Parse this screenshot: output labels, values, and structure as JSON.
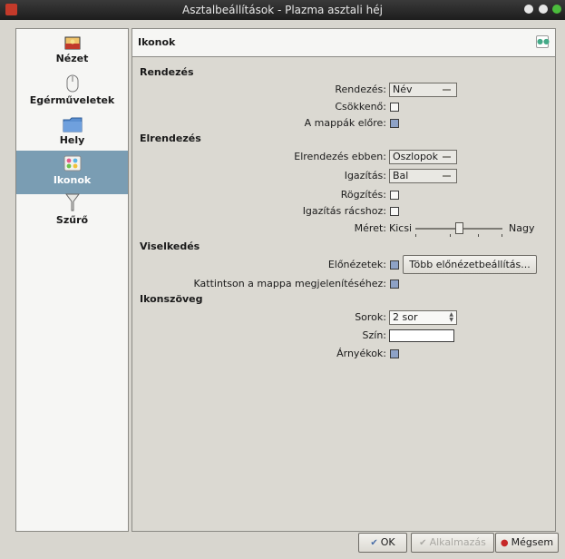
{
  "window": {
    "title": "Asztalbeállítások - Plazma asztali héj"
  },
  "sidebar": {
    "items": [
      {
        "label": "Nézet",
        "icon": "image-icon"
      },
      {
        "label": "Egérműveletek",
        "icon": "mouse-icon"
      },
      {
        "label": "Hely",
        "icon": "folder-icon"
      },
      {
        "label": "Ikonok",
        "icon": "icons-icon",
        "active": true
      },
      {
        "label": "Szűrő",
        "icon": "filter-icon"
      }
    ]
  },
  "header": {
    "title": "Ikonok"
  },
  "sections": {
    "rendezes": {
      "title": "Rendezés",
      "sort_label": "Rendezés:",
      "sort_value": "Név",
      "descending_label": "Csökkenő:",
      "folders_first_label": "A mappák előre:"
    },
    "elrendezes": {
      "title": "Elrendezés",
      "layout_label": "Elrendezés ebben:",
      "layout_value": "Oszlopok",
      "align_label": "Igazítás:",
      "align_value": "Bal",
      "lock_label": "Rögzítés:",
      "snap_label": "Igazítás rácshoz:",
      "size_label": "Méret:",
      "size_min": "Kicsi",
      "size_max": "Nagy"
    },
    "viselkedes": {
      "title": "Viselkedés",
      "previews_label": "Előnézetek:",
      "more_previews_button": "Több előnézetbeállítás...",
      "click_label": "Kattintson a mappa megjelenítéséhez:"
    },
    "ikonszoveg": {
      "title": "Ikonszöveg",
      "rows_label": "Sorok:",
      "rows_value": "2 sor",
      "color_label": "Szín:",
      "shadow_label": "Árnyékok:"
    }
  },
  "footer": {
    "ok": "OK",
    "apply": "Alkalmazás",
    "cancel": "Mégsem"
  },
  "state": {
    "descending": false,
    "folders_first": true,
    "lock": false,
    "snap_to_grid": false,
    "previews": true,
    "click_to_view": true,
    "shadows": true,
    "icon_size_level": 0.5
  }
}
